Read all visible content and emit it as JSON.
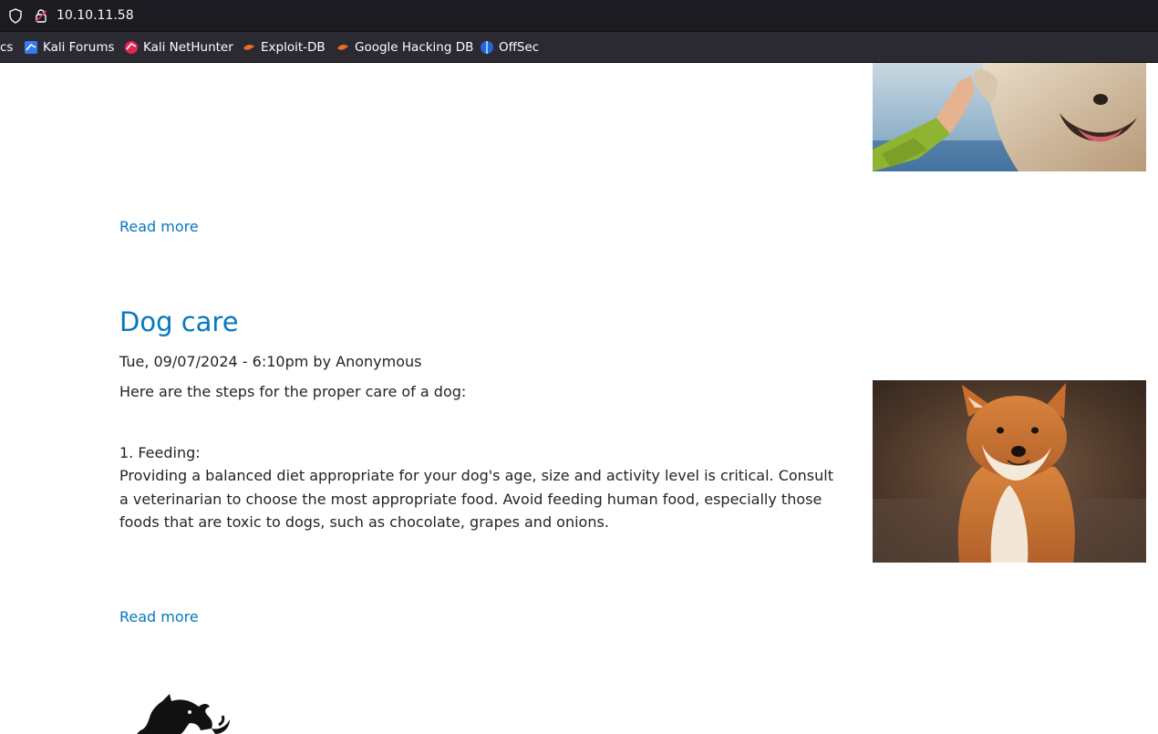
{
  "browser": {
    "url": "10.10.11.58",
    "bookmarks": [
      {
        "label": "cs",
        "icon": "docs-icon"
      },
      {
        "label": "Kali Forums",
        "icon": "kali-forums-icon"
      },
      {
        "label": "Kali NetHunter",
        "icon": "nethunter-icon"
      },
      {
        "label": "Exploit-DB",
        "icon": "exploit-db-icon"
      },
      {
        "label": "Google Hacking DB",
        "icon": "ghdb-icon"
      },
      {
        "label": "OffSec",
        "icon": "offsec-icon"
      }
    ]
  },
  "articles": [
    {
      "read_more": "Read more",
      "image_alt": "person giving high five to dog"
    },
    {
      "title": "Dog care",
      "meta": "Tue, 09/07/2024 - 6:10pm by Anonymous",
      "intro": "Here are the steps for the proper care of a dog:",
      "step_heading": "1. Feeding:",
      "step_text": "Providing a balanced diet appropriate for your dog's age, size and activity level is critical. Consult a veterinarian to choose the most appropriate food. Avoid feeding human food, especially those foods that are toxic to dogs, such as chocolate, grapes and onions.",
      "read_more": "Read more",
      "image_alt": "shiba inu dog sitting"
    }
  ],
  "colors": {
    "link": "#0678be",
    "text": "#232429",
    "chrome_dark": "#1c1b22",
    "bookmarks_bar": "#2b2a33"
  }
}
